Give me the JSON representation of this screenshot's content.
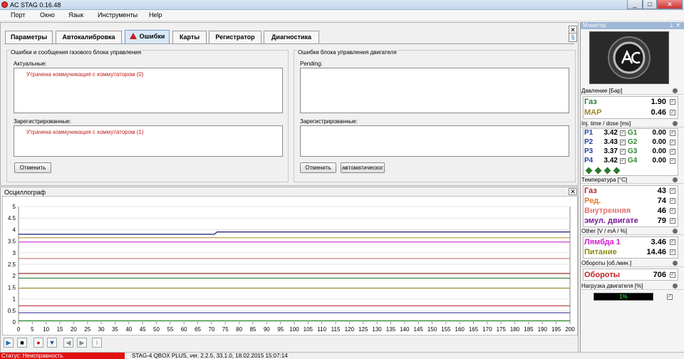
{
  "window": {
    "title": "AC STAG 0.16.48",
    "min": "_",
    "max": "□",
    "close": "✕"
  },
  "menu": [
    "Порт",
    "Окно",
    "Язык",
    "Инструменты",
    "Help"
  ],
  "tabs": [
    "Параметры",
    "Автокалибровка",
    "Ошибки",
    "Карты",
    "Регистратор",
    "Диагностика"
  ],
  "errors": {
    "gas_group": "Ошибки и сообщения газового блока управления",
    "actual_label": "Актуальные:",
    "actual_item": "Утрачена коммуникация с коммутатором (0)",
    "registered_label": "Зарегистрированные:",
    "registered_item": "Утрачена коммуникация с коммутатором (1)",
    "cancel_label": "Отменить",
    "engine_group": "Ошибки блока управления двигателя",
    "pending_label": "Pending:",
    "engine_registered_label": "Зарегистрированные:",
    "engine_cancel_label": "Отменить",
    "auto_label": "автоматическог"
  },
  "oscilloscope": {
    "title": "Осциллограф"
  },
  "chart_data": {
    "type": "line",
    "xlim": [
      0,
      200
    ],
    "ylim": [
      0,
      5
    ],
    "xticks": [
      0,
      5,
      10,
      15,
      20,
      25,
      30,
      35,
      40,
      45,
      50,
      55,
      60,
      65,
      70,
      75,
      80,
      85,
      90,
      95,
      100,
      105,
      110,
      115,
      120,
      125,
      130,
      135,
      140,
      145,
      150,
      155,
      160,
      165,
      170,
      175,
      180,
      185,
      190,
      195,
      200
    ],
    "yticks": [
      0,
      0.5,
      1,
      1.5,
      2,
      2.5,
      3,
      3.5,
      4,
      4.5,
      5
    ],
    "series": [
      {
        "color": "#1a1a6e",
        "points": [
          [
            0,
            3.8
          ],
          [
            71,
            3.8
          ],
          [
            72,
            3.9
          ],
          [
            200,
            3.9
          ]
        ]
      },
      {
        "color": "#c0a050",
        "points": [
          [
            0,
            3.65
          ],
          [
            200,
            3.65
          ]
        ]
      },
      {
        "color": "#e040e0",
        "points": [
          [
            0,
            3.46
          ],
          [
            200,
            3.46
          ]
        ]
      },
      {
        "color": "#d08080",
        "points": [
          [
            0,
            2.75
          ],
          [
            200,
            2.75
          ]
        ]
      },
      {
        "color": "#8b1a1a",
        "points": [
          [
            0,
            2.1
          ],
          [
            200,
            2.1
          ]
        ]
      },
      {
        "color": "#2e7d32",
        "points": [
          [
            0,
            1.9
          ],
          [
            200,
            1.9
          ]
        ]
      },
      {
        "color": "#9b8a2a",
        "points": [
          [
            0,
            1.46
          ],
          [
            200,
            1.46
          ]
        ]
      },
      {
        "color": "#b83030",
        "points": [
          [
            0,
            0.7
          ],
          [
            200,
            0.7
          ]
        ]
      },
      {
        "color": "#3c3c9c",
        "points": [
          [
            0,
            0.4
          ],
          [
            200,
            0.4
          ]
        ]
      },
      {
        "color": "#2e8b2e",
        "points": [
          [
            0,
            0.05
          ],
          [
            200,
            0.05
          ]
        ]
      }
    ]
  },
  "controls": [
    "▶",
    "■",
    "●",
    "▼",
    "◀",
    "▶",
    "i"
  ],
  "status": {
    "text": "Статус: Неисправность",
    "info": "STAG-4 QBOX PLUS, ver. 2.2.5, 33.1.0, 18.02.2015 15:07:14"
  },
  "monitor": {
    "title": "Монитор",
    "pin": "⊥ ✕",
    "pressure_label": "Давление [Бар]",
    "gas_label": "Газ",
    "gas_value": "1.90",
    "map_label": "MAP",
    "map_value": "0.46",
    "inj_label": "Inj. time / dose [ms]",
    "p1": "P1",
    "p1_value": "3.42",
    "g1": "G1",
    "g1_value": "0.00",
    "p2": "P2",
    "p2_value": "3.43",
    "g2": "G2",
    "g2_value": "0.00",
    "p3": "P3",
    "p3_value": "3.37",
    "g3": "G3",
    "g3_value": "0.00",
    "p4": "P4",
    "p4_value": "3.42",
    "g4": "G4",
    "g4_value": "0.00",
    "temp_label": "Температура [°C]",
    "t_gas_label": "Газ",
    "t_gas_value": "43",
    "t_red_label": "Ред.",
    "t_red_value": "74",
    "t_int_label": "Внутренняя",
    "t_int_value": "46",
    "t_emu_label": "эмул. двигате",
    "t_emu_value": "79",
    "other_label": "Other [V / mA / %]",
    "lambda_label": "Лямбда 1",
    "lambda_value": "3.46",
    "power_label": "Питание",
    "power_value": "14.46",
    "rpm_section": "Обороты [об./мин.]",
    "rpm_label": "Обороты",
    "rpm_value": "706",
    "load_label": "Нагрузка двигателя [%]",
    "load_value": "1%",
    "colors": {
      "gas": "#2e7d32",
      "map": "#9b8a2a",
      "p": "#1f3fa0",
      "g": "#2e8b2e",
      "t_gas": "#b0202a",
      "t_red": "#e07a2a",
      "t_int": "#e07070",
      "t_emu": "#7a1a9a",
      "lambda": "#d020d0",
      "power": "#8a8a1a",
      "rpm": "#c02020"
    }
  }
}
